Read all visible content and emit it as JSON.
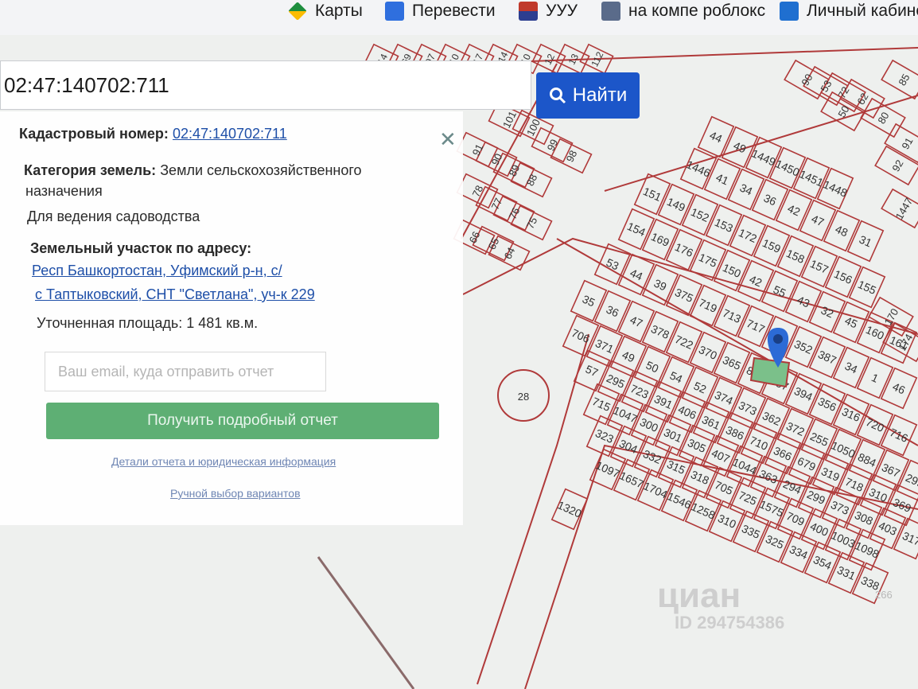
{
  "bookmarks": [
    {
      "label": "Карты",
      "icon": "maps-icon"
    },
    {
      "label": "Перевести",
      "icon": "translate-icon"
    },
    {
      "label": "УУУ",
      "icon": "app-icon"
    },
    {
      "label": "на компе роблокс",
      "icon": "bookmark-icon"
    },
    {
      "label": "Личный кабинет",
      "icon": "windows-icon"
    }
  ],
  "search": {
    "value": "02:47:140702:711",
    "button_label": "Найти"
  },
  "info": {
    "cadastral_label": "Кадастровый номер:",
    "cadastral_value": "02:47:140702:711",
    "category_label": "Категория земель:",
    "category_value_1": "Земли сельскохозяйственного",
    "category_value_2": "назначения",
    "usage": "Для ведения садоводства",
    "address_label": "Земельный участок по адресу:",
    "address_line_1": "Респ Башкортостан, Уфимский р-н, с/",
    "address_line_2": "с Таптыковский, СНТ \"Светлана\", уч-к 229",
    "area": "Уточненная площадь: 1 481 кв.м."
  },
  "report": {
    "email_placeholder": "Ваш email, куда отправить отчет",
    "button_label": "Получить подробный отчет",
    "details_link": "Детали отчета и юридическая информация",
    "manual_link": "Ручной выбор вариантов"
  },
  "map": {
    "line_color": "#b03a3a",
    "highlight_color": "#7bc08a",
    "pin_color": "#2c6bd6",
    "lake_label": "28",
    "parcels": [
      "44",
      "49",
      "1449",
      "1450",
      "1451",
      "1448",
      "1446",
      "41",
      "34",
      "36",
      "42",
      "47",
      "48",
      "31",
      "151",
      "149",
      "152",
      "153",
      "172",
      "159",
      "158",
      "157",
      "156",
      "155",
      "154",
      "169",
      "176",
      "175",
      "150",
      "42",
      "55",
      "43",
      "32",
      "45",
      "160",
      "161",
      "53",
      "44",
      "39",
      "375",
      "719",
      "713",
      "717",
      "703",
      "352",
      "387",
      "34",
      "1",
      "46",
      "35",
      "36",
      "47",
      "378",
      "722",
      "370",
      "365",
      "883",
      "357",
      "394",
      "356",
      "316",
      "720",
      "716",
      "706",
      "371",
      "49",
      "50",
      "54",
      "52",
      "374",
      "373",
      "362",
      "372",
      "255",
      "1050",
      "884",
      "367",
      "299",
      "57",
      "295",
      "723",
      "391",
      "406",
      "361",
      "386",
      "710",
      "366",
      "679",
      "319",
      "718",
      "310",
      "369",
      "364",
      "715",
      "1047",
      "300",
      "301",
      "305",
      "407",
      "1044",
      "363",
      "294",
      "299",
      "373",
      "308",
      "403",
      "317",
      "323",
      "304",
      "332",
      "315",
      "318",
      "705",
      "725",
      "1575",
      "709",
      "400",
      "1003",
      "1098",
      "1097",
      "1657",
      "1704",
      "1546",
      "1258",
      "310",
      "335",
      "325",
      "334",
      "354",
      "331",
      "338",
      "1320"
    ],
    "top_strip": [
      "14",
      "69",
      "07",
      "10",
      "17",
      "114",
      "10",
      "12",
      "13",
      "112"
    ],
    "left_parcels": [
      "100",
      "99",
      "98",
      "101",
      "91",
      "90",
      "89",
      "88",
      "78",
      "77",
      "76",
      "75",
      "66",
      "65",
      "64"
    ],
    "far_right": [
      "90",
      "53",
      "72",
      "62",
      "50",
      "80",
      "85",
      "91",
      "92",
      "1447",
      "170",
      "174"
    ],
    "watermark_brand": "циан",
    "watermark_id": "ID 294754386",
    "faint_label": "266"
  }
}
